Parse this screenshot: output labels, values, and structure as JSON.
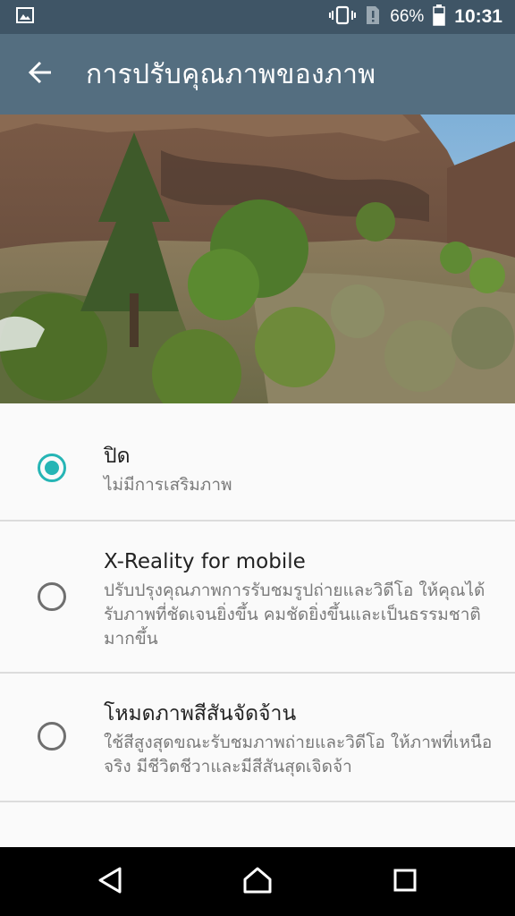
{
  "status_bar": {
    "battery_percent": "66%",
    "time": "10:31",
    "icons": [
      "image-notification-icon",
      "vibrate-icon",
      "no-sim-icon",
      "battery-icon"
    ]
  },
  "app_bar": {
    "title": "การปรับคุณภาพของภาพ",
    "back_icon": "arrow-back-icon"
  },
  "hero": {
    "description": "preview-landscape-photo"
  },
  "options": [
    {
      "title": "ปิด",
      "description": "ไม่มีการเสริมภาพ",
      "selected": true
    },
    {
      "title": "X-Reality for mobile",
      "description": "ปรับปรุงคุณภาพการรับชมรูปถ่ายและวิดีโอ ให้คุณได้รับภาพที่ชัดเจนยิ่งขึ้น คมชัดยิ่งขึ้นและเป็นธรรมชาติมากขึ้น",
      "selected": false
    },
    {
      "title": "โหมดภาพสีสันจัดจ้าน",
      "description": "ใช้สีสูงสุดขณะรับชมภาพถ่ายและวิดีโอ ให้ภาพที่เหนือจริง มีชีวิตชีวาและมีสีสันสุดเจิดจ้า",
      "selected": false
    }
  ],
  "nav_bar": {
    "icons": [
      "back-triangle-icon",
      "home-icon",
      "recents-icon"
    ]
  },
  "colors": {
    "status_bar": "#3f5566",
    "app_bar": "#546e80",
    "accent": "#26b5b5"
  }
}
